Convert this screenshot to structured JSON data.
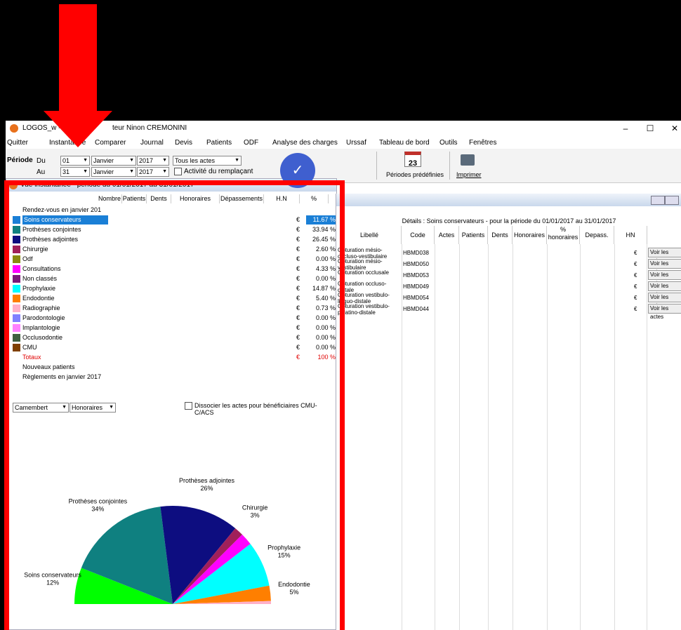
{
  "window": {
    "title": "LOGOS_w - Ach… teur Ninon CREMONINI",
    "title_visible": "LOGOS_w -",
    "title_right": "teur Ninon CREMONINI"
  },
  "menu": [
    "Quitter",
    "Instantanée",
    "Comparer",
    "Journal",
    "Devis",
    "Patients",
    "ODF",
    "Analyse des charges",
    "Urssaf",
    "Tableau de bord",
    "Outils",
    "Fenêtres"
  ],
  "toolbar": {
    "periode_label": "Période",
    "du_label": "Du",
    "au_label": "Au",
    "du_day": "01",
    "du_month": "Janvier",
    "du_year": "2017",
    "au_day": "31",
    "au_month": "Janvier",
    "au_year": "2017",
    "actes_select": "Tous les actes",
    "remplacant_label": "Activité du remplaçant",
    "periodes_label": "Périodes prédéfinies",
    "calendar_day": "23",
    "imprimer_label": "Imprimer"
  },
  "left_panel": {
    "title": "Vue instantanée - période du 01/01/2017 au 31/01/2017",
    "columns": [
      "Nombre",
      "Patients",
      "Dents",
      "Honoraires",
      "Dépassements",
      "H.N",
      "%"
    ],
    "rows": [
      {
        "label": "Rendez-vous en janvier 201",
        "color": "",
        "eur": "",
        "pct": ""
      },
      {
        "label": "Soins conservateurs",
        "color": "#1a7fd6",
        "eur": "€",
        "pct": "11.67 %"
      },
      {
        "label": "Prothèses conjointes",
        "color": "#0f8080",
        "eur": "€",
        "pct": "33.94 %"
      },
      {
        "label": "Prothèses adjointes",
        "color": "#0d0d80",
        "eur": "€",
        "pct": "26.45 %"
      },
      {
        "label": "Chirurgie",
        "color": "#a0205a",
        "eur": "€",
        "pct": "2.60 %"
      },
      {
        "label": "Odf",
        "color": "#8a8a10",
        "eur": "€",
        "pct": "0.00 %"
      },
      {
        "label": "Consultations",
        "color": "#ff00ff",
        "eur": "€",
        "pct": "4.33 %"
      },
      {
        "label": "Non classés",
        "color": "#7a1a7a",
        "eur": "€",
        "pct": "0.00 %"
      },
      {
        "label": "Prophylaxie",
        "color": "#00ffff",
        "eur": "€",
        "pct": "14.87 %"
      },
      {
        "label": "Endodontie",
        "color": "#ff7f00",
        "eur": "€",
        "pct": "5.40 %"
      },
      {
        "label": "Radiographie",
        "color": "#ffb0c8",
        "eur": "€",
        "pct": "0.73 %"
      },
      {
        "label": "Parodontologie",
        "color": "#8080ff",
        "eur": "€",
        "pct": "0.00 %"
      },
      {
        "label": "Implantologie",
        "color": "#ff80ff",
        "eur": "€",
        "pct": "0.00 %"
      },
      {
        "label": "Occlusodontie",
        "color": "#406040",
        "eur": "€",
        "pct": "0.00 %"
      },
      {
        "label": "CMU",
        "color": "#804000",
        "eur": "€",
        "pct": "0.00 %"
      },
      {
        "label": "Totaux",
        "color": "",
        "eur": "€",
        "pct": "100 %"
      },
      {
        "label": "Nouveaux patients",
        "color": "",
        "eur": "",
        "pct": ""
      },
      {
        "label": "Règlements en janvier 2017",
        "color": "",
        "eur": "",
        "pct": ""
      }
    ],
    "chart_type_select": "Camembert",
    "measure_select": "Honoraires",
    "dissocier_label": "Dissocier les actes pour bénéficiaires CMU-C/ACS"
  },
  "chart_data": {
    "type": "pie",
    "slices": [
      {
        "name": "Soins conservateurs",
        "value": 12,
        "label": "12%",
        "color": "#00ff00"
      },
      {
        "name": "Prothèses conjointes",
        "value": 34,
        "label": "34%",
        "color": "#0f8080"
      },
      {
        "name": "Prothèses adjointes",
        "value": 26,
        "label": "26%",
        "color": "#0d0d80"
      },
      {
        "name": "Chirurgie",
        "value": 3,
        "label": "3%",
        "color": "#a0205a"
      },
      {
        "name": "Consultations",
        "value": 4,
        "label": "",
        "color": "#ff00ff"
      },
      {
        "name": "Prophylaxie",
        "value": 15,
        "label": "15%",
        "color": "#00ffff"
      },
      {
        "name": "Endodontie",
        "value": 5,
        "label": "5%",
        "color": "#ff7f00"
      },
      {
        "name": "Radiographie",
        "value": 1,
        "label": "",
        "color": "#ffb0c8"
      }
    ]
  },
  "right_panel": {
    "title": "Détails : Soins conservateurs - pour la période du 01/01/2017 au 31/01/2017",
    "columns": [
      "Libellé",
      "Code",
      "Actes",
      "Patients",
      "Dents",
      "Honoraires",
      "% honoraires",
      "Depass.",
      "HN"
    ],
    "rows": [
      {
        "label": "Obturation mésio-occluso-vestibulaire",
        "code": "HBMD038",
        "eur": "€",
        "btn": "Voir les actes"
      },
      {
        "label": "Obturation mésio-vestibulaire",
        "code": "HBMD050",
        "eur": "€",
        "btn": "Voir les actes"
      },
      {
        "label": "Obturation occlusale",
        "code": "HBMD053",
        "eur": "€",
        "btn": "Voir les actes"
      },
      {
        "label": "Obturation occluso-distale",
        "code": "HBMD049",
        "eur": "€",
        "btn": "Voir les actes"
      },
      {
        "label": "Obturation vestibulo-linguo-distale",
        "code": "HBMD054",
        "eur": "€",
        "btn": "Voir les actes"
      },
      {
        "label": "Obturation vestibulo-palatino-distale",
        "code": "HBMD044",
        "eur": "€",
        "btn": "Voir les actes"
      }
    ]
  },
  "ok_check": "✓",
  "window_controls": [
    "–",
    "☐",
    "✕"
  ]
}
